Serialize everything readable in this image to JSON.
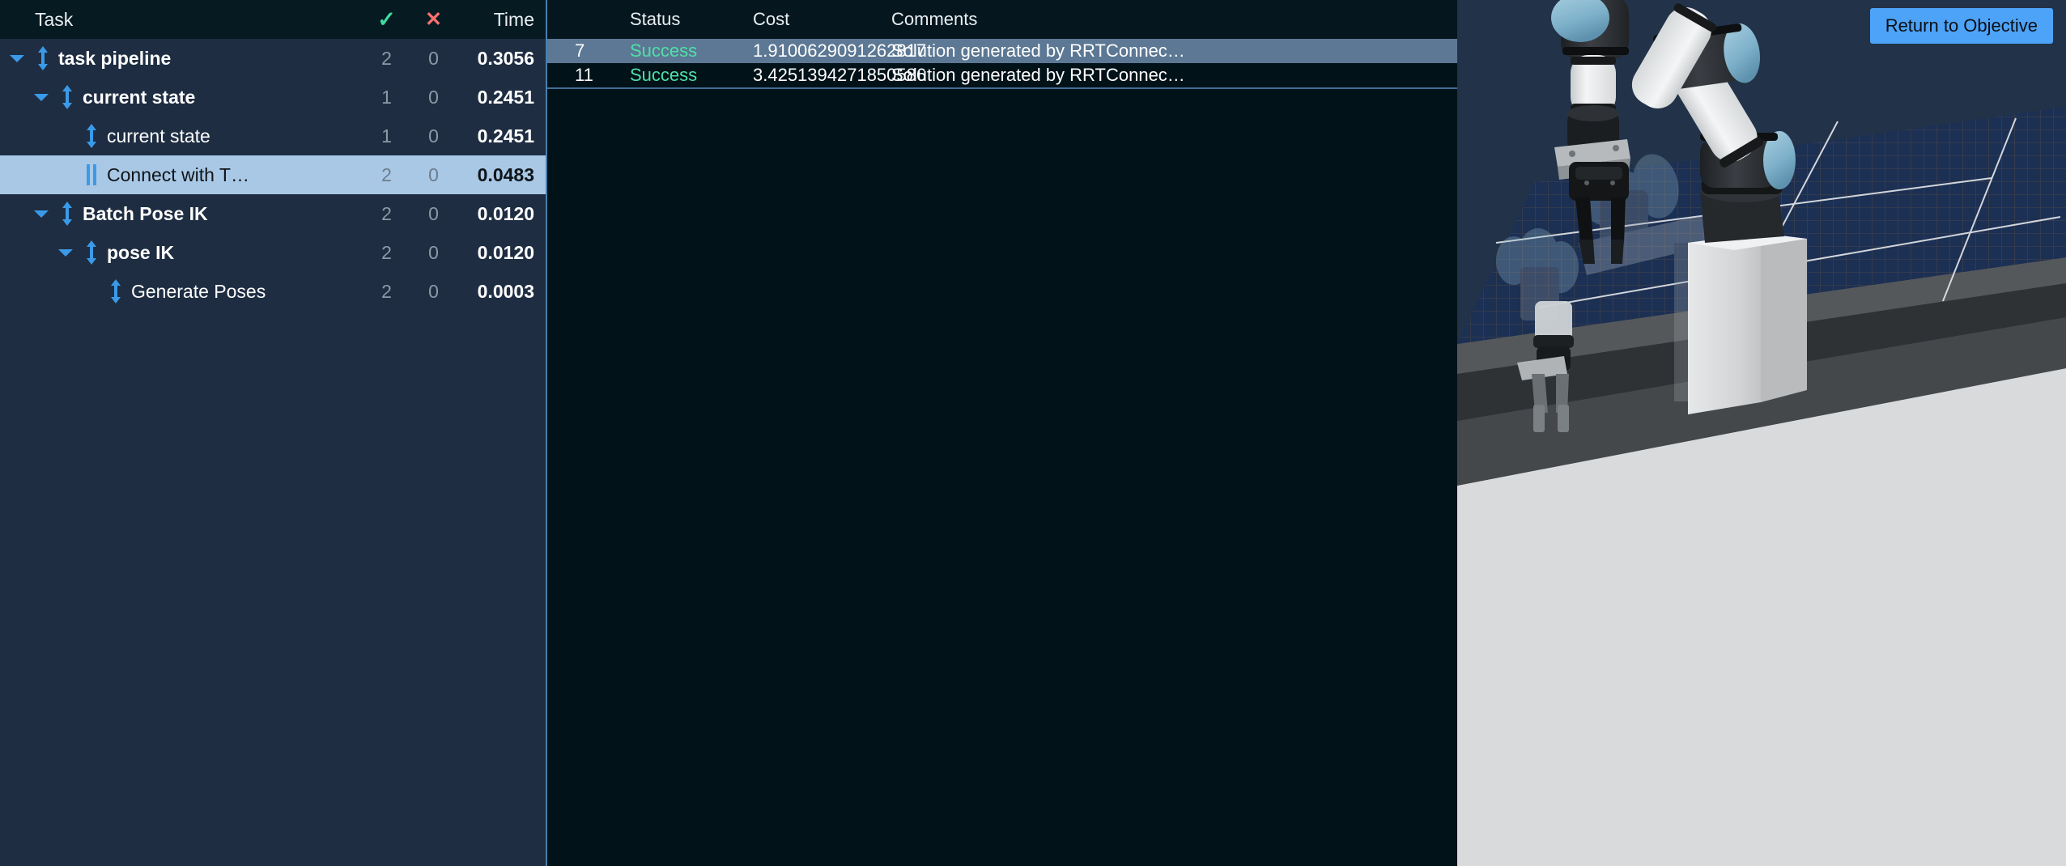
{
  "task_panel": {
    "header": {
      "task_label": "Task",
      "success_icon": "check-icon",
      "success_icon_glyph": "✓",
      "failure_icon": "cross-icon",
      "failure_icon_glyph": "✕",
      "time_label": "Time"
    },
    "rows": [
      {
        "label": "task pipeline",
        "depth": 0,
        "bold": true,
        "expanded": true,
        "has_chevron": true,
        "icon": "solution-arrows-icon",
        "successes": "2",
        "failures": "0",
        "time": "0.3056",
        "selected": false
      },
      {
        "label": "current state",
        "depth": 1,
        "bold": true,
        "expanded": true,
        "has_chevron": true,
        "icon": "solution-arrows-icon",
        "successes": "1",
        "failures": "0",
        "time": "0.2451",
        "selected": false
      },
      {
        "label": "current state",
        "depth": 2,
        "bold": false,
        "expanded": false,
        "has_chevron": false,
        "icon": "solution-arrows-icon",
        "successes": "1",
        "failures": "0",
        "time": "0.2451",
        "selected": false
      },
      {
        "label": "Connect with T…",
        "depth": 2,
        "bold": false,
        "expanded": false,
        "has_chevron": false,
        "icon": "connect-bars-icon",
        "successes": "2",
        "failures": "0",
        "time": "0.0483",
        "selected": true
      },
      {
        "label": "Batch Pose IK",
        "depth": 1,
        "bold": true,
        "expanded": true,
        "has_chevron": true,
        "icon": "solution-arrows-icon",
        "successes": "2",
        "failures": "0",
        "time": "0.0120",
        "selected": false
      },
      {
        "label": "pose IK",
        "depth": 2,
        "bold": true,
        "expanded": true,
        "has_chevron": true,
        "icon": "solution-arrows-icon",
        "successes": "2",
        "failures": "0",
        "time": "0.0120",
        "selected": false
      },
      {
        "label": "Generate Poses",
        "depth": 3,
        "bold": false,
        "expanded": false,
        "has_chevron": false,
        "icon": "solution-arrows-icon",
        "successes": "2",
        "failures": "0",
        "time": "0.0003",
        "selected": false
      }
    ]
  },
  "solutions_panel": {
    "columns": {
      "id": "",
      "status": "Status",
      "cost": "Cost",
      "comments": "Comments"
    },
    "rows": [
      {
        "id": "7",
        "status": "Success",
        "cost": "1.9100629091262817",
        "comments": "Solution generated by RRTConnec…",
        "selected": true
      },
      {
        "id": "11",
        "status": "Success",
        "cost": "3.4251394271850586",
        "comments": "Solution generated by RRTConnec…",
        "selected": false
      }
    ]
  },
  "viewport": {
    "return_button": "Return to Objective",
    "scene_name": "robot-arm-3d-scene"
  },
  "colors": {
    "accent_blue": "#4da3f7",
    "tree_background": "#1e2d42",
    "tree_header_background": "#061a22",
    "selected_tree_row": "#a8c8e6",
    "solutions_background": "#021219",
    "selected_solution_row": "#5c7894",
    "success_green": "#4fe0a8",
    "check_green": "#3ddca0",
    "cross_red": "#f5706e",
    "viewport_background": "#223349",
    "divider": "#4a7fae"
  }
}
